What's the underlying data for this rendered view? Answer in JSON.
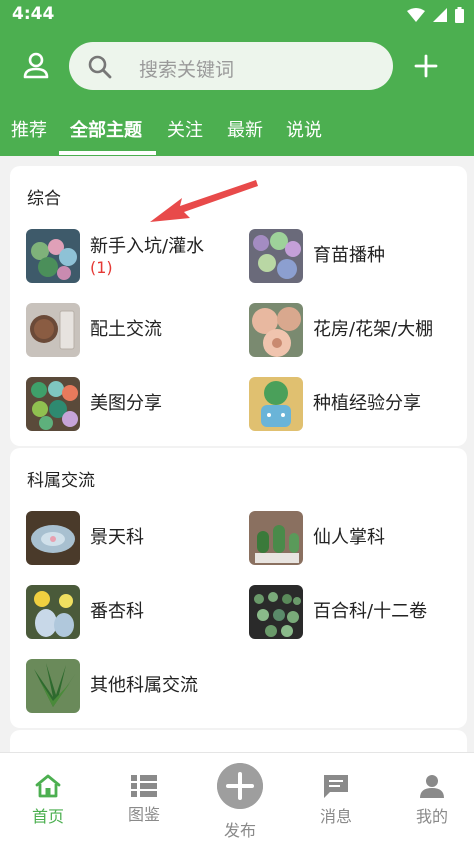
{
  "status": {
    "time": "4:44"
  },
  "search": {
    "placeholder": "搜索关键词"
  },
  "tabs": [
    {
      "label": "推荐"
    },
    {
      "label": "全部主题"
    },
    {
      "label": "关注"
    },
    {
      "label": "最新"
    },
    {
      "label": "说说"
    }
  ],
  "sections": [
    {
      "title": "综合",
      "items": [
        {
          "label": "新手入坑/灌水",
          "count": "(1)"
        },
        {
          "label": "育苗播种"
        },
        {
          "label": "配土交流"
        },
        {
          "label": "花房/花架/大棚"
        },
        {
          "label": "美图分享"
        },
        {
          "label": "种植经验分享"
        }
      ]
    },
    {
      "title": "科属交流",
      "items": [
        {
          "label": "景天科"
        },
        {
          "label": "仙人掌科"
        },
        {
          "label": "番杏科"
        },
        {
          "label": "百合科/十二卷"
        },
        {
          "label": "其他科属交流"
        }
      ]
    }
  ],
  "bottom_nav": [
    {
      "label": "首页",
      "icon": "home-icon"
    },
    {
      "label": "图鉴",
      "icon": "catalog-icon"
    },
    {
      "label": "发布",
      "icon": "add-circle-icon"
    },
    {
      "label": "消息",
      "icon": "message-icon"
    },
    {
      "label": "我的",
      "icon": "person-icon"
    }
  ],
  "colors": {
    "primary": "#4caf50",
    "count": "#e53935"
  }
}
